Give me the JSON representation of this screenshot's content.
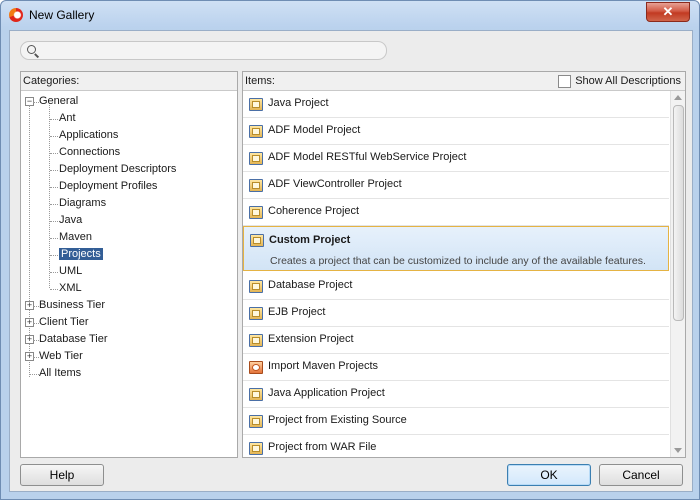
{
  "window": {
    "title": "New Gallery",
    "close_label": "✕"
  },
  "search": {
    "placeholder": ""
  },
  "categories": {
    "header": "Categories:",
    "general": "General",
    "general_children": [
      "Ant",
      "Applications",
      "Connections",
      "Deployment Descriptors",
      "Deployment Profiles",
      "Diagrams",
      "Java",
      "Maven",
      "Projects",
      "UML",
      "XML"
    ],
    "selected": "Projects",
    "collapsed": [
      "Business Tier",
      "Client Tier",
      "Database Tier",
      "Web Tier"
    ],
    "all_items": "All Items"
  },
  "items": {
    "header": "Items:",
    "show_all_label": "Show All Descriptions",
    "list": [
      {
        "label": "Java Project",
        "icon": "folder-project-icon"
      },
      {
        "label": "ADF Model Project",
        "icon": "folder-project-icon"
      },
      {
        "label": "ADF Model RESTful WebService Project",
        "icon": "folder-project-icon"
      },
      {
        "label": "ADF ViewController Project",
        "icon": "folder-project-icon"
      },
      {
        "label": "Coherence Project",
        "icon": "folder-project-icon"
      },
      {
        "label": "Custom Project",
        "icon": "folder-project-icon",
        "selected": true,
        "description": "Creates a project that can be customized to include any of the available features."
      },
      {
        "label": "Database Project",
        "icon": "folder-project-icon"
      },
      {
        "label": "EJB Project",
        "icon": "folder-project-icon"
      },
      {
        "label": "Extension Project",
        "icon": "folder-project-icon"
      },
      {
        "label": "Import Maven Projects",
        "icon": "maven-icon"
      },
      {
        "label": "Java Application Project",
        "icon": "folder-project-icon"
      },
      {
        "label": "Project from Existing Source",
        "icon": "folder-project-icon"
      },
      {
        "label": "Project from WAR File",
        "icon": "folder-project-icon"
      }
    ]
  },
  "buttons": {
    "help": "Help",
    "ok": "OK",
    "cancel": "Cancel"
  }
}
